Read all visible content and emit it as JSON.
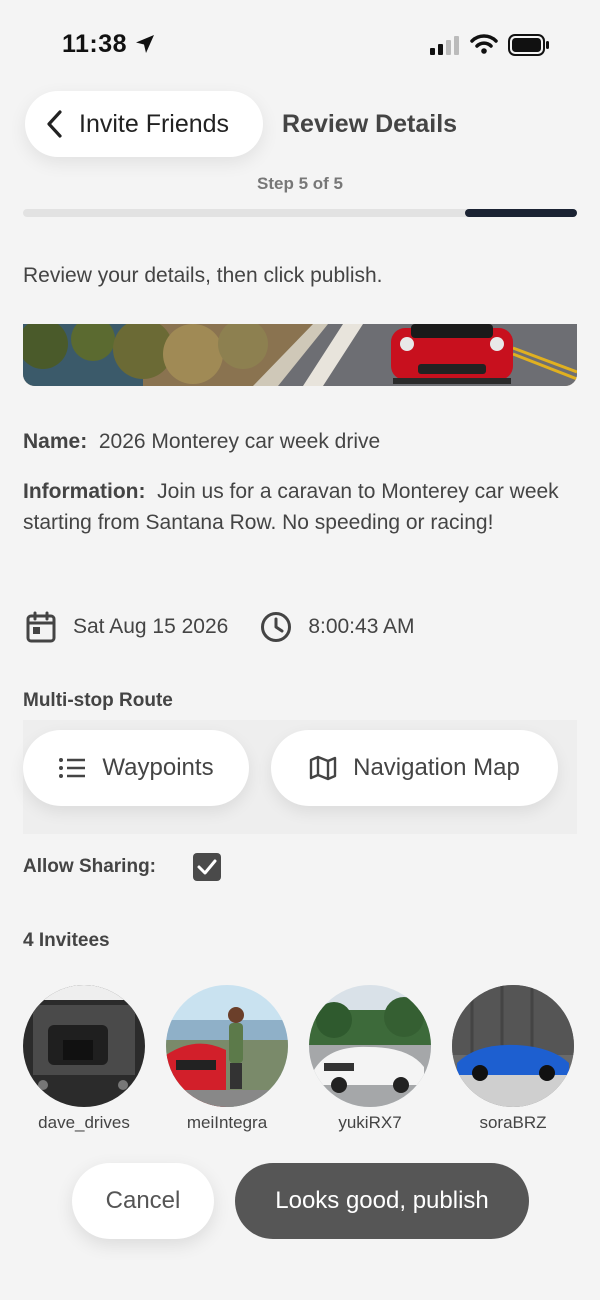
{
  "status_bar": {
    "time": "11:38"
  },
  "header": {
    "back_label": "Invite Friends",
    "title": "Review Details"
  },
  "progress": {
    "step_text": "Step 5 of 5",
    "current_step": 5,
    "total_steps": 5
  },
  "instructions": "Review your details, then click publish.",
  "details": {
    "name_label": "Name:",
    "name_value": "2026 Monterey car week drive",
    "info_label": "Information:",
    "info_value": "Join us for a caravan to Monterey car week starting from Santana Row. No speeding or racing!",
    "date": "Sat Aug 15 2026",
    "time": "8:00:43 AM"
  },
  "route": {
    "label": "Multi-stop Route",
    "waypoints_label": "Waypoints",
    "map_label": "Navigation Map"
  },
  "sharing": {
    "label": "Allow Sharing:",
    "checked": true
  },
  "invitees": {
    "label": "4 Invitees",
    "items": [
      {
        "username": "dave_drives"
      },
      {
        "username": "meiIntegra"
      },
      {
        "username": "yukiRX7"
      },
      {
        "username": "soraBRZ"
      }
    ]
  },
  "actions": {
    "cancel_label": "Cancel",
    "publish_label": "Looks good, publish"
  },
  "colors": {
    "progress_fill": "#1b2333",
    "publish_bg": "#565656",
    "background": "#f4f4f4"
  }
}
